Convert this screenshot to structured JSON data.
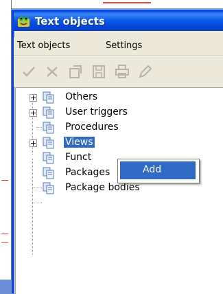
{
  "window": {
    "title": "Text objects",
    "app_icon": "frog-app-icon"
  },
  "menu": {
    "items": [
      {
        "label": "Text objects"
      },
      {
        "label": "Settings"
      }
    ]
  },
  "toolbar": {
    "icons": [
      "check-icon",
      "delete-icon",
      "copy-icon",
      "save-icon",
      "print-icon",
      "edit-icon"
    ]
  },
  "tree": {
    "items": [
      {
        "label": "Others",
        "expandable": true,
        "selected": false
      },
      {
        "label": "User triggers",
        "expandable": true,
        "selected": false
      },
      {
        "label": "Procedures",
        "expandable": false,
        "selected": false
      },
      {
        "label": "Views",
        "expandable": true,
        "selected": true
      },
      {
        "label": "Funct",
        "expandable": false,
        "selected": false
      },
      {
        "label": "Packages",
        "expandable": false,
        "selected": false
      },
      {
        "label": "Package bodies",
        "expandable": false,
        "selected": false
      }
    ]
  },
  "context_menu": {
    "items": [
      {
        "label": "Add",
        "highlighted": true
      }
    ]
  },
  "colors": {
    "title_blue": "#0a5be8",
    "selection": "#316ac5"
  }
}
